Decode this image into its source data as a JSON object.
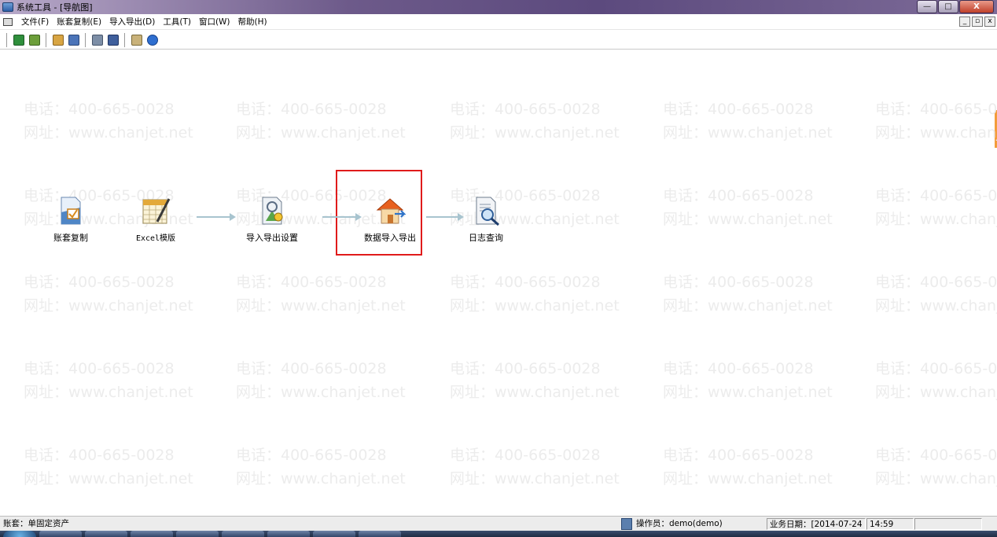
{
  "window": {
    "title": "系统工具 - [导航图]",
    "buttons": {
      "minimize": "—",
      "maximize": "□",
      "close": "X"
    }
  },
  "menu": {
    "items": [
      "文件(F)",
      "账套复制(E)",
      "导入导出(D)",
      "工具(T)",
      "窗口(W)",
      "帮助(H)"
    ],
    "mdi_buttons": {
      "minimize": "_",
      "restore": "▫",
      "close": "x"
    }
  },
  "toolbar": {
    "buttons": [
      "excel-icon",
      "import-icon",
      "tools-icon",
      "copy-icon",
      "print-icon",
      "calculator-icon",
      "edit-icon",
      "help-icon"
    ]
  },
  "watermark": {
    "phone": "电话：400-665-0028",
    "website": "网址：www.chanjet.net"
  },
  "flow": {
    "nodes": [
      {
        "label": "账套复制",
        "icon": "account-copy-icon"
      },
      {
        "label": "Excel模版",
        "icon": "excel-template-icon"
      },
      {
        "label": "导入导出设置",
        "icon": "import-export-settings-icon"
      },
      {
        "label": "数据导入导出",
        "icon": "house-icon"
      },
      {
        "label": "日志查询",
        "icon": "log-search-icon"
      }
    ]
  },
  "status": {
    "account": "账套：单固定资产",
    "operator": "操作员：demo(demo)",
    "business_date": "业务日期：[2014-07-24",
    "time": "14:59"
  },
  "colors": {
    "highlight": "#e01b1b",
    "arrow": "#a8c4cf",
    "watermark": "#ececec",
    "titlebar": "#5c4a7e"
  }
}
